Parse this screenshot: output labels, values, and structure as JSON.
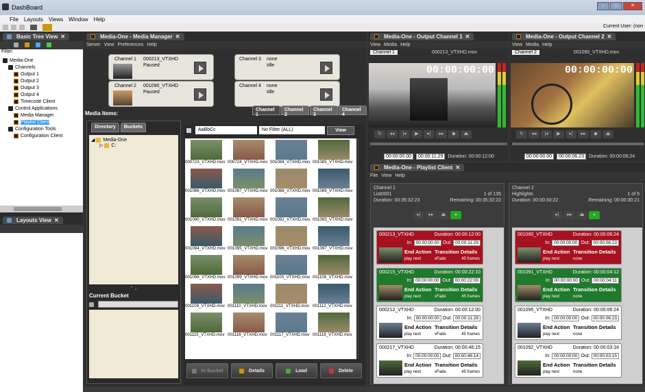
{
  "window": {
    "title": "DashBoard",
    "current_user_label": "Current User: (non"
  },
  "menu": [
    "File",
    "Layouts",
    "Views",
    "Window",
    "Help"
  ],
  "tree_pane": {
    "title": "Basic Tree View",
    "filter_label": "Filter:",
    "items": [
      {
        "label": "Media-One",
        "level": 0
      },
      {
        "label": "Channels",
        "level": 1
      },
      {
        "label": "Output 1",
        "level": 2
      },
      {
        "label": "Output 2",
        "level": 2
      },
      {
        "label": "Output 3",
        "level": 2
      },
      {
        "label": "Output 4",
        "level": 2
      },
      {
        "label": "Timecode Client",
        "level": 2
      },
      {
        "label": "Control Applications",
        "level": 1
      },
      {
        "label": "Media Manager",
        "level": 2
      },
      {
        "label": "Playlist Client",
        "level": 2
      },
      {
        "label": "Configuration Tools",
        "level": 1
      },
      {
        "label": "Configuration Client",
        "level": 2
      }
    ]
  },
  "layouts_pane": {
    "title": "Layouts View"
  },
  "media_manager": {
    "tab": "Media-One - Media Manager",
    "menu": [
      "Server",
      "View",
      "Preferences",
      "Help"
    ],
    "channels": [
      {
        "name": "Channel 1",
        "clip": "000213_VTXHD",
        "state": "Paused"
      },
      {
        "name": "Channel 3",
        "clip": "none",
        "state": "Idle"
      },
      {
        "name": "Channel 2",
        "clip": "001090_VTXHD",
        "state": "Paused"
      },
      {
        "name": "Channel 4",
        "clip": "none",
        "state": "Idle"
      }
    ],
    "media_items_label": "Media Items:",
    "channel_tabs": [
      "Channel 1",
      "Channel 2",
      "Channel 3",
      "Channel 4"
    ],
    "dir_tabs": [
      "Directory",
      "Buckets"
    ],
    "dir_tree": [
      "Media-One",
      "C:"
    ],
    "current_bucket_label": "Current Bucket",
    "search_value": "AaBbCc",
    "filter_value": "No Filter (ALL)",
    "view_button": "View",
    "thumbs": [
      "001088_VTXHD.mov",
      "000723_VTXHD.mov",
      "000724_VTXHD.mov",
      "001084_VTXHD.mov",
      "001085_VTXHD.mov",
      "001086_VTXHD.mov",
      "001087_VTXHD.mov",
      "001088_VTXHD.mov",
      "001089_VTXHD.mov",
      "001090_VTXHD.mov",
      "001091_VTXHD.mov",
      "001092_VTXHD.mov",
      "001093_VTXHD.mov",
      "001094_VTXHD.mov",
      "001095_VTXHD.mov",
      "001096_VTXHD.mov",
      "001097_VTXHD.mov",
      "001098_VTXHD.mov",
      "001099_VTXHD.mov",
      "001100_VTXHD.mov",
      "001108_VTXHD.mov",
      "001109_VTXHD.mov",
      "001110_VTXHD.mov",
      "001111_VTXHD.mov",
      "001112_VTXHD.mov",
      "001115_VTXHD.mov",
      "001116_VTXHD.mov",
      "001117_VTXHD.mov",
      "001118_VTXHD.mov"
    ],
    "buttons": [
      "to Bucket",
      "Details",
      "Load",
      "Delete"
    ]
  },
  "output1": {
    "tab": "Media-One - Output Channel 1",
    "menu": [
      "View",
      "Media",
      "Help"
    ],
    "channel": "Channel 1",
    "file": "000213_VTXHD.mov",
    "timecode": "00:00:00:00",
    "in": "00:00:00.00",
    "out": "00:00:11.29",
    "duration": "Duration: 00:00:12:00"
  },
  "output2": {
    "tab": "Media-One - Output Channel 2",
    "menu": [
      "View",
      "Media",
      "Help"
    ],
    "channel": "Channel 2",
    "file": "001090_VTXHD.mov",
    "timecode": "00:00:00:00",
    "in": "00:00:00.00",
    "out": "00:00:06.23",
    "duration": "Duration: 00:00:06:24"
  },
  "playlist": {
    "tab": "Media-One - Playlist Client",
    "menu": [
      "File",
      "View",
      "Help"
    ],
    "ch1": {
      "name": "Channel 1",
      "list": "List0001",
      "count": "1 of 135",
      "duration": "Duration: 00:35:32:23",
      "remaining": "Remaining: 00:35:32:22",
      "items": [
        {
          "name": "000213_VTXHD",
          "dur": "Duration: 00:00:12:00",
          "in": "00:00:00:00",
          "out": "00:00:11:29",
          "ea": "play next",
          "td": "xFade",
          "frames": "45 frames",
          "color": "red"
        },
        {
          "name": "000215_VTXHD",
          "dur": "Duration: 00:00:22:10",
          "in": "00:00:00:00",
          "out": "00:00:22:09",
          "ea": "play next",
          "td": "xFade",
          "frames": "45 frames",
          "color": "green"
        },
        {
          "name": "000212_VTXHD",
          "dur": "Duration: 00:00:12:00",
          "in": "00:00:00:00",
          "out": "00:00:11:29",
          "ea": "play next",
          "td": "vFade",
          "frames": "45 frames",
          "color": "wht"
        },
        {
          "name": "000217_VTXHD",
          "dur": "Duration: 00:00:46:15",
          "in": "00:00:00:00",
          "out": "00:00:46:14",
          "ea": "play next",
          "td": "vFade",
          "frames": "45 frames",
          "color": "wht"
        }
      ]
    },
    "ch2": {
      "name": "Channel 2",
      "list": "Highlights",
      "count": "1 of 5",
      "duration": "Duration: 00:00:30:22",
      "remaining": "Remaining: 00:00:30:21",
      "items": [
        {
          "name": "001090_VTXHD",
          "dur": "Duration: 00:00:06:24",
          "in": "00:00:00:00",
          "out": "00:00:06:23",
          "ea": "play next",
          "td": "none",
          "frames": "",
          "color": "red"
        },
        {
          "name": "001091_VTXHD",
          "dur": "Duration: 00:00:04:12",
          "in": "00:00:00:00",
          "out": "00:00:04:11",
          "ea": "play next",
          "td": "none",
          "frames": "",
          "color": "green"
        },
        {
          "name": "001095_VTXHD",
          "dur": "Duration: 00:00:06:24",
          "in": "00:00:00:00",
          "out": "00:00:06:23",
          "ea": "play next",
          "td": "none",
          "frames": "",
          "color": "wht"
        },
        {
          "name": "001092_VTXHD",
          "dur": "Duration: 00:00:03:16",
          "in": "00:00:00:00",
          "out": "00:00:03:15",
          "ea": "play next",
          "td": "none",
          "frames": "",
          "color": "wht"
        }
      ]
    },
    "labels": {
      "in": "In:",
      "out": "Out:",
      "end_action": "End Action",
      "transition": "Transition Details"
    }
  }
}
